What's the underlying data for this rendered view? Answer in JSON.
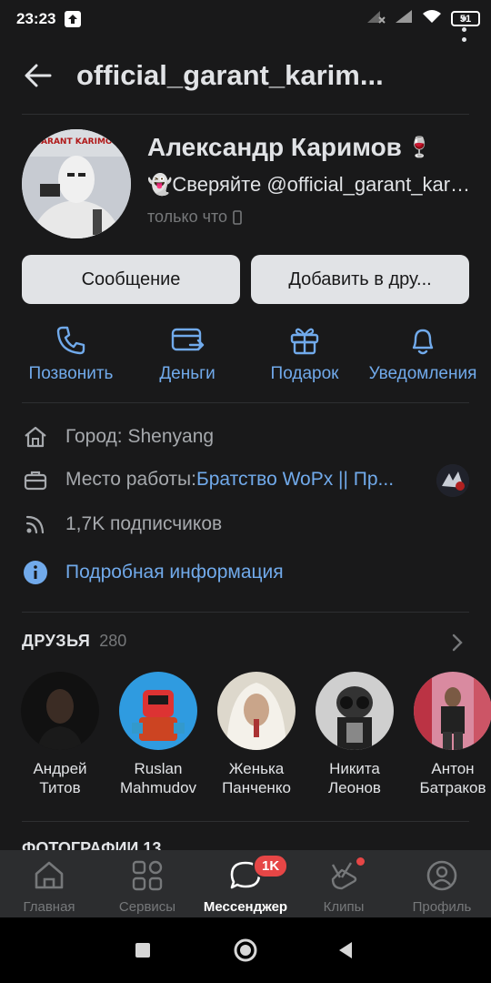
{
  "status_bar": {
    "time": "23:23",
    "battery": "51"
  },
  "header": {
    "title": "official_garant_karim..."
  },
  "profile": {
    "name": "Александр Каримов",
    "name_emoji": "🍷",
    "status": "👻Сверяйте @official_garant_karimov",
    "last_seen": "только что"
  },
  "buttons": {
    "message": "Сообщение",
    "add_friend": "Добавить в дру..."
  },
  "actions": [
    {
      "label": "Позвонить",
      "icon": "phone-icon"
    },
    {
      "label": "Деньги",
      "icon": "money-transfer-icon"
    },
    {
      "label": "Подарок",
      "icon": "gift-icon"
    },
    {
      "label": "Уведомления",
      "icon": "bell-icon"
    }
  ],
  "info": {
    "city": "Город: Shenyang",
    "work_label": "Место работы: ",
    "work_value": "Братство WoPx || Пр...",
    "followers": "1,7K подписчиков",
    "details": "Подробная информация"
  },
  "friends": {
    "title": "ДРУЗЬЯ",
    "count": "280",
    "items": [
      {
        "first": "Андрей",
        "last": "Титов"
      },
      {
        "first": "Ruslan",
        "last": "Mahmudov"
      },
      {
        "first": "Женька",
        "last": "Панченко"
      },
      {
        "first": "Никита",
        "last": "Леонов"
      },
      {
        "first": "Антон",
        "last": "Батраков"
      }
    ]
  },
  "photos": {
    "title": "ФОТОГРАФИИ 13"
  },
  "tabbar": {
    "items": [
      {
        "label": "Главная",
        "icon": "home-icon"
      },
      {
        "label": "Сервисы",
        "icon": "services-icon"
      },
      {
        "label": "Мессенджер",
        "icon": "messenger-icon",
        "badge": "1K"
      },
      {
        "label": "Клипы",
        "icon": "clips-icon"
      },
      {
        "label": "Профиль",
        "icon": "profile-icon"
      }
    ]
  },
  "colors": {
    "accent": "#71aaeb",
    "background": "#19191a",
    "badge": "#e64646"
  }
}
